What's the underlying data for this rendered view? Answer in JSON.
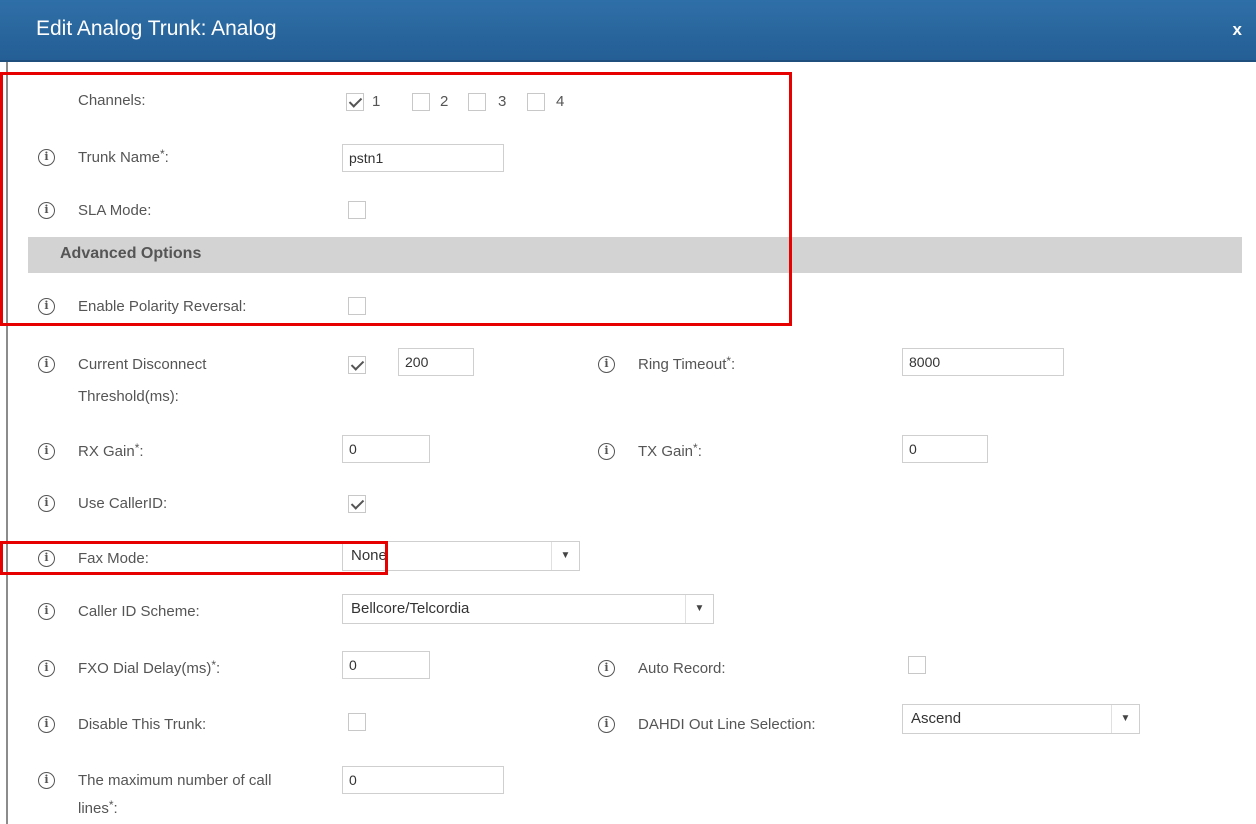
{
  "dialog": {
    "title": "Edit Analog Trunk: Analog",
    "close": "x"
  },
  "channels": {
    "label": "Channels:",
    "items": [
      {
        "num": "1",
        "checked": true
      },
      {
        "num": "2",
        "checked": false
      },
      {
        "num": "3",
        "checked": false
      },
      {
        "num": "4",
        "checked": false
      }
    ]
  },
  "trunk_name": {
    "label": "Trunk Name",
    "req": "*",
    "colon": ":",
    "value": "pstn1"
  },
  "sla_mode": {
    "label": "SLA Mode:",
    "checked": false
  },
  "advanced": {
    "title": "Advanced Options"
  },
  "polarity": {
    "label": "Enable Polarity Reversal:",
    "checked": false
  },
  "disconnect": {
    "label1": "Current Disconnect",
    "label2": "Threshold(ms):",
    "checked": true,
    "value": "200"
  },
  "ring_timeout": {
    "label": "Ring Timeout",
    "req": "*",
    "colon": ":",
    "value": "8000"
  },
  "rx_gain": {
    "label": "RX Gain",
    "req": "*",
    "colon": ":",
    "value": "0"
  },
  "tx_gain": {
    "label": "TX Gain",
    "req": "*",
    "colon": ":",
    "value": "0"
  },
  "callerid": {
    "label": "Use CallerID:",
    "checked": true
  },
  "fax_mode": {
    "label": "Fax Mode:",
    "value": "None"
  },
  "callerid_scheme": {
    "label": "Caller ID Scheme:",
    "value": "Bellcore/Telcordia"
  },
  "fxo_delay": {
    "label": "FXO Dial Delay(ms)",
    "req": "*",
    "colon": ":",
    "value": "0"
  },
  "auto_record": {
    "label": "Auto Record:",
    "checked": false
  },
  "disable_trunk": {
    "label": "Disable This Trunk:",
    "checked": false
  },
  "dahdi": {
    "label": "DAHDI Out Line Selection:",
    "value": "Ascend"
  },
  "max_lines": {
    "label1": "The maximum number of call",
    "label2": "lines",
    "req": "*",
    "colon": ":",
    "value": "0"
  },
  "icons": {
    "info": "info-icon",
    "dropdown": "chevron-down-icon",
    "check": "check-icon"
  },
  "colors": {
    "titlebar": "#2a68a0",
    "highlight": "#e60000",
    "section": "#d3d3d3"
  }
}
